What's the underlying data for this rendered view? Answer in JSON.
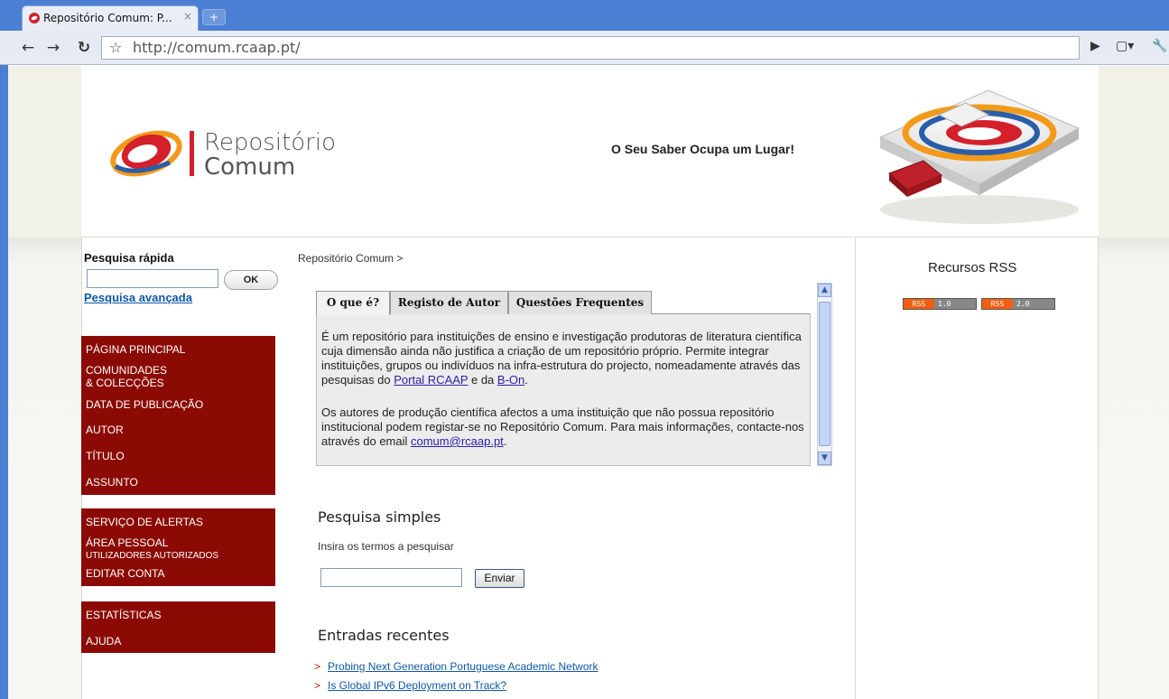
{
  "browser": {
    "tab_title": "Repositório Comum: P...",
    "tab_close": "×",
    "new_tab": "+",
    "url": "http://comum.rcaap.pt/"
  },
  "header": {
    "logo_line1": "Repositório",
    "logo_line2": "Comum",
    "slogan": "O Seu Saber Ocupa um Lugar!"
  },
  "sidebar": {
    "quick_search_title": "Pesquisa rápida",
    "ok_label": "OK",
    "advanced_search": "Pesquisa avançada",
    "menu1": [
      "PÁGINA PRINCIPAL",
      "COMUNIDADES",
      "& COLECÇÕES",
      "DATA DE PUBLICAÇÃO",
      "AUTOR",
      "TÍTULO",
      "ASSUNTO"
    ],
    "menu2": [
      "SERVIÇO DE ALERTAS",
      "ÁREA PESSOAL",
      "UTILIZADORES AUTORIZADOS",
      "EDITAR CONTA"
    ],
    "menu3": [
      "ESTATÍSTICAS",
      "AJUDA"
    ]
  },
  "main": {
    "breadcrumb": "Repositório Comum >",
    "tabs": [
      "O que é?",
      "Registo de Autor",
      "Questões Frequentes"
    ],
    "para1_a": "É um repositório para instituições de ensino e investigação produtoras de literatura científica cuja dimensão ainda não justifica a criação de um repositório próprio. Permite integrar instituições, grupos ou indivíduos na infra-estrutura do projecto, nomeadamente através das pesquisas do ",
    "link_portal": "Portal RCAAP",
    "para1_b": " e da ",
    "link_bon": "B-On",
    "para1_c": ".",
    "para2_a": "Os autores de produção científica afectos a uma instituição que não possua repositório institucional podem registar-se no Repositório Comum. Para mais informações, contacte-nos através do email ",
    "link_email": "comum@rcaap.pt",
    "para2_b": ".",
    "simple_search_title": "Pesquisa simples",
    "simple_search_label": "Insira os termos a pesquisar",
    "send_label": "Enviar",
    "recent_title": "Entradas recentes",
    "recent_bullet": ">",
    "recent": [
      "Probing Next Generation Portuguese Academic Network",
      "Is Global IPv6 Deployment on Track?"
    ]
  },
  "rss": {
    "title": "Recursos RSS",
    "badges": [
      {
        "left": "RSS",
        "right": "1.0"
      },
      {
        "left": "RSS",
        "right": "2.0"
      }
    ]
  },
  "colors": {
    "menu_bg": "#8b0a03",
    "link": "#0e58a6",
    "brand_red": "#d4202b"
  }
}
